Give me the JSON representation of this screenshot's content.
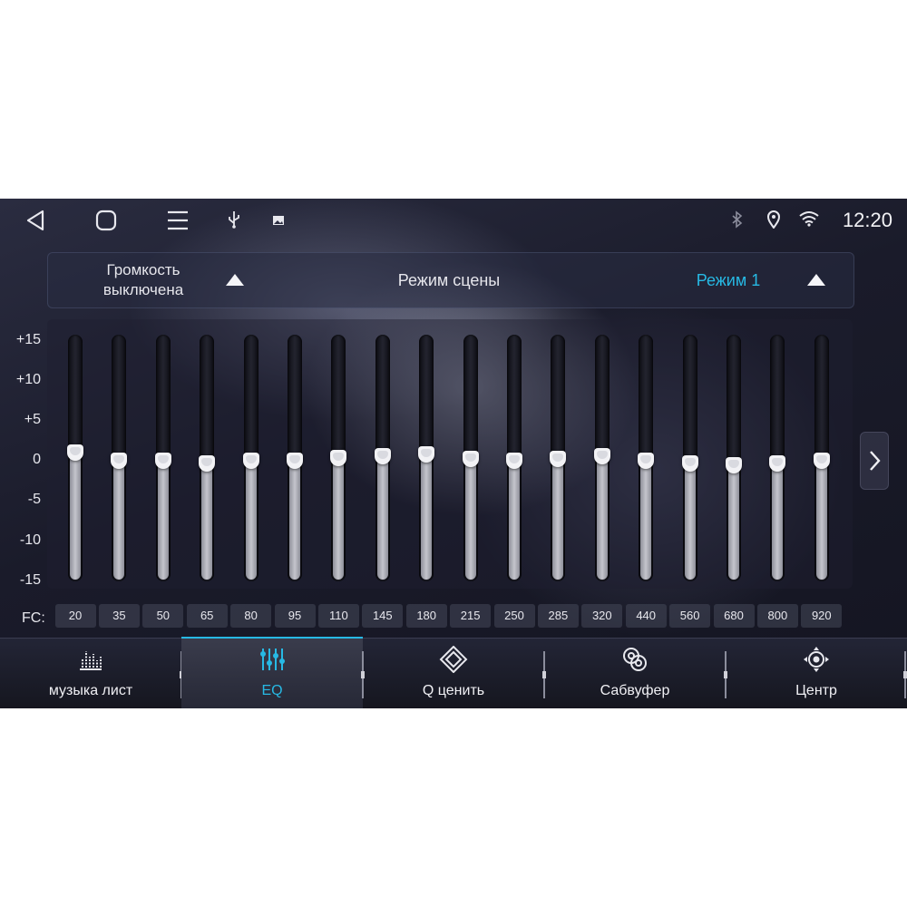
{
  "status_bar": {
    "time": "12:20",
    "nav_icons": [
      "back-icon",
      "home-icon",
      "menu-icon",
      "usb-icon",
      "image-icon"
    ],
    "right_icons": [
      "bluetooth-icon",
      "location-icon",
      "wifi-icon"
    ]
  },
  "mode_panel": {
    "volume_label": "Громкость выключена",
    "scene_label": "Режим сцены",
    "mode_value": "Режим 1"
  },
  "eq": {
    "db_labels": [
      "+15",
      "+10",
      "+5",
      "0",
      "-5",
      "-10",
      "-15"
    ],
    "fc_label": "FC:",
    "bands": [
      {
        "freq": "20",
        "gain": 1
      },
      {
        "freq": "35",
        "gain": 0
      },
      {
        "freq": "50",
        "gain": 0
      },
      {
        "freq": "65",
        "gain": -0.3
      },
      {
        "freq": "80",
        "gain": 0
      },
      {
        "freq": "95",
        "gain": 0
      },
      {
        "freq": "110",
        "gain": 0.3
      },
      {
        "freq": "145",
        "gain": 0.6
      },
      {
        "freq": "180",
        "gain": 0.8
      },
      {
        "freq": "215",
        "gain": 0.2
      },
      {
        "freq": "250",
        "gain": 0
      },
      {
        "freq": "285",
        "gain": 0.2
      },
      {
        "freq": "320",
        "gain": 0.6
      },
      {
        "freq": "440",
        "gain": 0
      },
      {
        "freq": "560",
        "gain": -0.3
      },
      {
        "freq": "680",
        "gain": -0.6
      },
      {
        "freq": "800",
        "gain": -0.3
      },
      {
        "freq": "920",
        "gain": 0
      }
    ],
    "gain_range": [
      -15,
      15
    ]
  },
  "tabs": [
    {
      "label": "музыка лист",
      "icon": "music-list-icon",
      "active": false
    },
    {
      "label": "EQ",
      "icon": "equalizer-icon",
      "active": true
    },
    {
      "label": "Q ценить",
      "icon": "q-value-icon",
      "active": false
    },
    {
      "label": "Сабвуфер",
      "icon": "subwoofer-icon",
      "active": false
    },
    {
      "label": "Центр",
      "icon": "center-icon",
      "active": false
    }
  ],
  "colors": {
    "accent": "#27b9e4",
    "text": "#e8e8ee"
  }
}
